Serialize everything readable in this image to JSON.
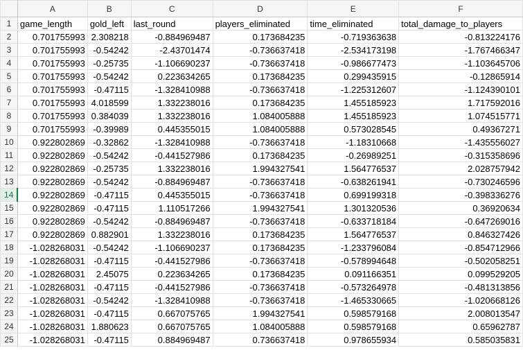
{
  "columns": [
    "A",
    "B",
    "C",
    "D",
    "E",
    "F"
  ],
  "active_row": "14",
  "rows": [
    {
      "n": "1",
      "cells": [
        "game_length",
        "gold_left",
        "last_round",
        "players_eliminated",
        "time_eliminated",
        "total_damage_to_players"
      ]
    },
    {
      "n": "2",
      "cells": [
        "0.701755993",
        "2.308218",
        "-0.884969487",
        "0.173684235",
        "-0.719363638",
        "-0.813224176"
      ]
    },
    {
      "n": "3",
      "cells": [
        "0.701755993",
        "-0.54242",
        "-2.43701474",
        "-0.736637418",
        "-2.534173198",
        "-1.767466347"
      ]
    },
    {
      "n": "4",
      "cells": [
        "0.701755993",
        "-0.25735",
        "-1.106690237",
        "-0.736637418",
        "-0.986677473",
        "-1.103645706"
      ]
    },
    {
      "n": "5",
      "cells": [
        "0.701755993",
        "-0.54242",
        "0.223634265",
        "0.173684235",
        "0.299435915",
        "-0.12865914"
      ]
    },
    {
      "n": "6",
      "cells": [
        "0.701755993",
        "-0.47115",
        "-1.328410988",
        "-0.736637418",
        "-1.225312607",
        "-1.124390101"
      ]
    },
    {
      "n": "7",
      "cells": [
        "0.701755993",
        "4.018599",
        "1.332238016",
        "0.173684235",
        "1.455185923",
        "1.717592016"
      ]
    },
    {
      "n": "8",
      "cells": [
        "0.701755993",
        "0.384039",
        "1.332238016",
        "1.084005888",
        "1.455185923",
        "1.074515771"
      ]
    },
    {
      "n": "9",
      "cells": [
        "0.701755993",
        "-0.39989",
        "0.445355015",
        "1.084005888",
        "0.573028545",
        "0.49367271"
      ]
    },
    {
      "n": "10",
      "cells": [
        "0.922802869",
        "-0.32862",
        "-1.328410988",
        "-0.736637418",
        "-1.18310668",
        "-1.435556027"
      ]
    },
    {
      "n": "11",
      "cells": [
        "0.922802869",
        "-0.54242",
        "-0.441527986",
        "0.173684235",
        "-0.26989251",
        "-0.315358696"
      ]
    },
    {
      "n": "12",
      "cells": [
        "0.922802869",
        "-0.25735",
        "1.332238016",
        "1.994327541",
        "1.564776537",
        "2.028757942"
      ]
    },
    {
      "n": "13",
      "cells": [
        "0.922802869",
        "-0.54242",
        "-0.884969487",
        "-0.736637418",
        "-0.638261941",
        "-0.730246596"
      ]
    },
    {
      "n": "14",
      "cells": [
        "0.922802869",
        "-0.47115",
        "0.445355015",
        "-0.736637418",
        "0.699199318",
        "-0.398336276"
      ]
    },
    {
      "n": "15",
      "cells": [
        "0.922802869",
        "-0.47115",
        "1.110517266",
        "1.994327541",
        "1.301320536",
        "0.36920634"
      ]
    },
    {
      "n": "16",
      "cells": [
        "0.922802869",
        "-0.54242",
        "-0.884969487",
        "-0.736637418",
        "-0.633718184",
        "-0.647269016"
      ]
    },
    {
      "n": "17",
      "cells": [
        "0.922802869",
        "0.882901",
        "1.332238016",
        "0.173684235",
        "1.564776537",
        "0.846327426"
      ]
    },
    {
      "n": "18",
      "cells": [
        "-1.028268031",
        "-0.54242",
        "-1.106690237",
        "0.173684235",
        "-1.233796084",
        "-0.854712966"
      ]
    },
    {
      "n": "19",
      "cells": [
        "-1.028268031",
        "-0.47115",
        "-0.441527986",
        "-0.736637418",
        "-0.578994648",
        "-0.502058251"
      ]
    },
    {
      "n": "20",
      "cells": [
        "-1.028268031",
        "2.45075",
        "0.223634265",
        "0.173684235",
        "0.091166351",
        "0.099529205"
      ]
    },
    {
      "n": "21",
      "cells": [
        "-1.028268031",
        "-0.47115",
        "-0.441527986",
        "-0.736637418",
        "-0.573264978",
        "-0.481313856"
      ]
    },
    {
      "n": "22",
      "cells": [
        "-1.028268031",
        "-0.54242",
        "-1.328410988",
        "-0.736637418",
        "-1.465330665",
        "-1.020668126"
      ]
    },
    {
      "n": "23",
      "cells": [
        "-1.028268031",
        "-0.47115",
        "0.667075765",
        "1.994327541",
        "0.598579168",
        "2.008013547"
      ]
    },
    {
      "n": "24",
      "cells": [
        "-1.028268031",
        "1.880623",
        "0.667075765",
        "1.084005888",
        "0.598579168",
        "0.65962787"
      ]
    },
    {
      "n": "25",
      "cells": [
        "-1.028268031",
        "-0.47115",
        "0.884969487",
        "0.736637418",
        "0.978655934",
        "0.585035831"
      ]
    }
  ]
}
